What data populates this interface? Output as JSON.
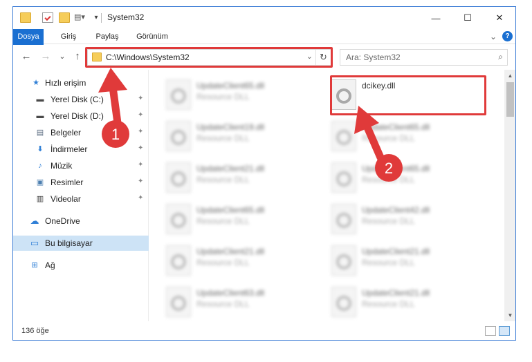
{
  "window": {
    "title": "System32",
    "minimize_glyph": "—",
    "maximize_glyph": "☐",
    "close_glyph": "✕"
  },
  "ribbon": {
    "tabs": [
      "Dosya",
      "Giriş",
      "Paylaş",
      "Görünüm"
    ],
    "collapse_glyph": "⌄",
    "help_glyph": "?"
  },
  "navigation": {
    "back_glyph": "←",
    "forward_glyph": "→",
    "recent_glyph": "⌄",
    "up_glyph": "↑"
  },
  "address": {
    "path": "C:\\Windows\\System32",
    "dropdown_glyph": "⌄",
    "refresh_glyph": "↻"
  },
  "search": {
    "placeholder": "Ara: System32",
    "icon": "search-icon",
    "glyph": "⌕"
  },
  "sidebar": {
    "items": [
      {
        "label": "Hızlı erişim",
        "icon": "star-icon",
        "glyph": "★",
        "color": "#2f7fd6",
        "pinned": false
      },
      {
        "label": "Yerel Disk (C:)",
        "icon": "drive-icon",
        "glyph": "▬",
        "color": "#4a4a4a",
        "pinned": true
      },
      {
        "label": "Yerel Disk (D:)",
        "icon": "drive-icon",
        "glyph": "▬",
        "color": "#4a4a4a",
        "pinned": true
      },
      {
        "label": "Belgeler",
        "icon": "documents-icon",
        "glyph": "▤",
        "color": "#5a6b80",
        "pinned": true
      },
      {
        "label": "İndirmeler",
        "icon": "download-icon",
        "glyph": "⬇",
        "color": "#2f7fd6",
        "pinned": true
      },
      {
        "label": "Müzik",
        "icon": "music-icon",
        "glyph": "♪",
        "color": "#2f7fd6",
        "pinned": true
      },
      {
        "label": "Resimler",
        "icon": "pictures-icon",
        "glyph": "▣",
        "color": "#4d7fb0",
        "pinned": true
      },
      {
        "label": "Videolar",
        "icon": "videos-icon",
        "glyph": "▥",
        "color": "#3a3a3a",
        "pinned": true
      },
      {
        "label": "OneDrive",
        "icon": "cloud-icon",
        "glyph": "☁",
        "color": "#2f7fd6",
        "pinned": false
      },
      {
        "label": "Bu bilgisayar",
        "icon": "computer-icon",
        "glyph": "▭",
        "color": "#2f7fd6",
        "pinned": false,
        "selected": true
      },
      {
        "label": "Ağ",
        "icon": "network-icon",
        "glyph": "⊞",
        "color": "#2f7fd6",
        "pinned": false
      }
    ],
    "pin_glyph": "📌"
  },
  "files": {
    "left_column": [
      {
        "name": "UpdateClient65.dll",
        "type": "Resource DLL"
      },
      {
        "name": "UpdateClient19.dll",
        "type": "Resource DLL"
      },
      {
        "name": "UpdateClient21.dll",
        "type": "Resource DLL"
      },
      {
        "name": "UpdateClient65.dll",
        "type": "Resource DLL"
      },
      {
        "name": "UpdateClient21.dll",
        "type": "Resource DLL"
      },
      {
        "name": "UpdateClient63.dll",
        "type": "Resource DLL"
      }
    ],
    "right_column": [
      {
        "name": "dcikey.dll",
        "type": ""
      },
      {
        "name": "UpdateClient65.dll",
        "type": "Resource DLL"
      },
      {
        "name": "UpdateClient65.dll",
        "type": "Resource DLL"
      },
      {
        "name": "UpdateClient42.dll",
        "type": "Resource DLL"
      },
      {
        "name": "UpdateClient21.dll",
        "type": "Resource DLL"
      },
      {
        "name": "UpdateClient21.dll",
        "type": "Resource DLL"
      }
    ]
  },
  "status": {
    "item_count": "136 öğe"
  },
  "annotations": {
    "badge_1": "1",
    "badge_2": "2",
    "highlight_color": "#e03a3a"
  },
  "colors": {
    "accent": "#1a6fd1",
    "selection": "#cde3f6"
  }
}
